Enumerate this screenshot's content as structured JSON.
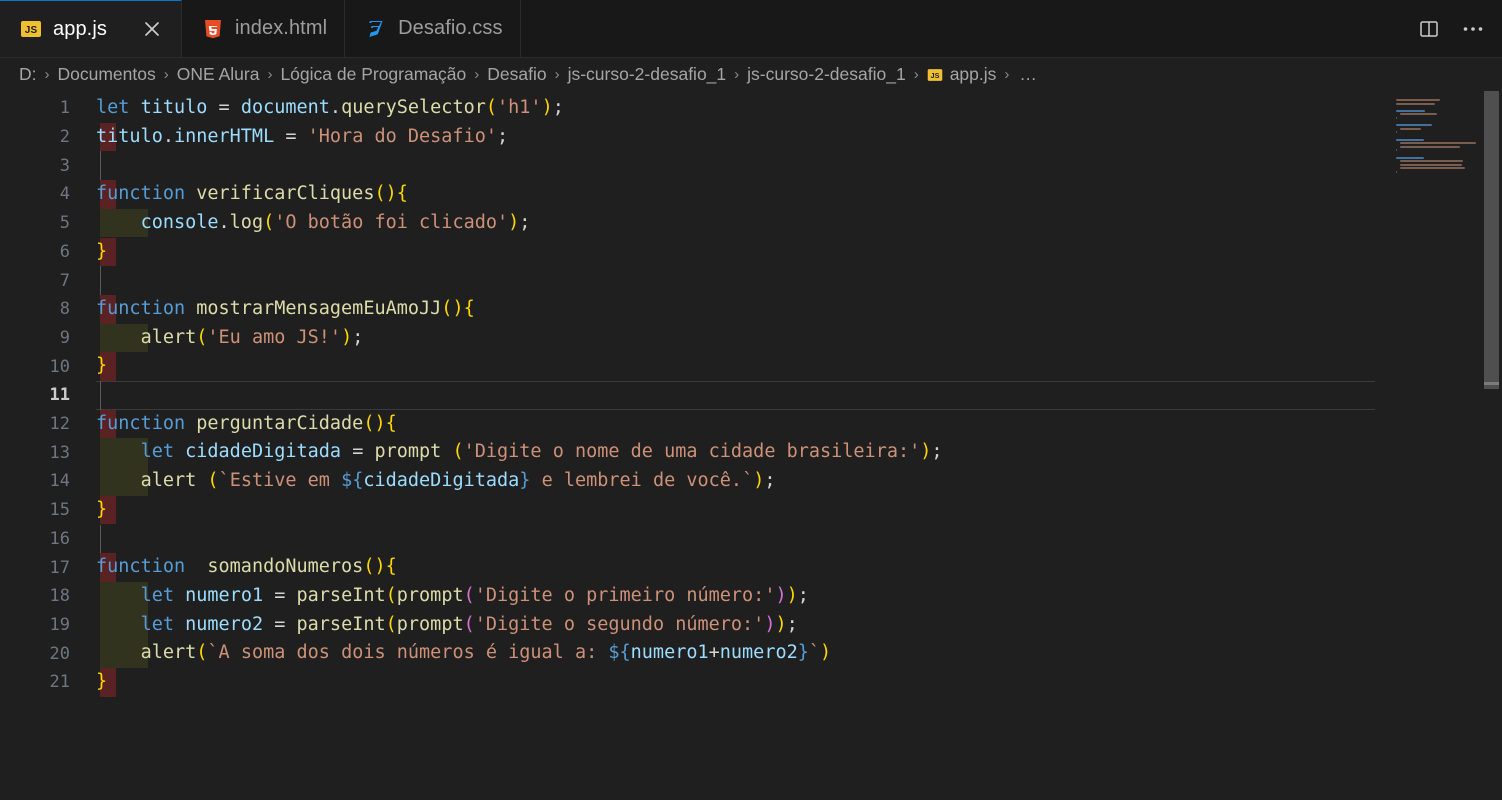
{
  "window": {
    "background": "#1f1f1f",
    "accent": "#0078d4"
  },
  "tabs": [
    {
      "label": "app.js",
      "icon": "js-file-icon",
      "active": true,
      "close_icon": "close-icon"
    },
    {
      "label": "index.html",
      "icon": "html-file-icon",
      "active": false
    },
    {
      "label": "Desafio.css",
      "icon": "css-file-icon",
      "active": false
    }
  ],
  "tab_actions": [
    {
      "name": "split-editor-right-icon",
      "label": "Split Editor Right"
    },
    {
      "name": "more-actions-icon",
      "label": "More Actions..."
    }
  ],
  "breadcrumb": {
    "separator": "›",
    "items": [
      {
        "label": "D:"
      },
      {
        "label": "Documentos"
      },
      {
        "label": "ONE Alura"
      },
      {
        "label": "Lógica de Programação"
      },
      {
        "label": "Desafio"
      },
      {
        "label": "js-curso-2-desafio_1"
      },
      {
        "label": "js-curso-2-desafio_1"
      },
      {
        "label": "app.js",
        "icon": "js-file-icon"
      }
    ],
    "ellipsis": "…"
  },
  "editor": {
    "active_line": 11,
    "language": "javascript",
    "lines": [
      {
        "n": 1,
        "git_modified": false,
        "indent_highlight": false,
        "text": "let titulo = document.querySelector('h1');"
      },
      {
        "n": 2,
        "git_modified": true,
        "indent_highlight": false,
        "text": "titulo.innerHTML = 'Hora do Desafio';"
      },
      {
        "n": 3,
        "git_modified": false,
        "indent_highlight": false,
        "text": ""
      },
      {
        "n": 4,
        "git_modified": true,
        "indent_highlight": false,
        "text": "function verificarCliques(){"
      },
      {
        "n": 5,
        "git_modified": false,
        "indent_highlight": true,
        "text": "    console.log('O botão foi clicado');"
      },
      {
        "n": 6,
        "git_modified": true,
        "indent_highlight": false,
        "text": "}"
      },
      {
        "n": 7,
        "git_modified": false,
        "indent_highlight": false,
        "text": ""
      },
      {
        "n": 8,
        "git_modified": true,
        "indent_highlight": false,
        "text": "function mostrarMensagemEuAmoJJ(){"
      },
      {
        "n": 9,
        "git_modified": false,
        "indent_highlight": true,
        "text": "    alert('Eu amo JS!');"
      },
      {
        "n": 10,
        "git_modified": true,
        "indent_highlight": false,
        "text": "}"
      },
      {
        "n": 11,
        "git_modified": false,
        "indent_highlight": false,
        "text": ""
      },
      {
        "n": 12,
        "git_modified": true,
        "indent_highlight": false,
        "text": "function perguntarCidade(){"
      },
      {
        "n": 13,
        "git_modified": false,
        "indent_highlight": true,
        "text": "    let cidadeDigitada = prompt ('Digite o nome de uma cidade brasileira:');"
      },
      {
        "n": 14,
        "git_modified": false,
        "indent_highlight": true,
        "text": "    alert (`Estive em ${cidadeDigitada} e lembrei de você.`);"
      },
      {
        "n": 15,
        "git_modified": true,
        "indent_highlight": false,
        "text": "}"
      },
      {
        "n": 16,
        "git_modified": false,
        "indent_highlight": false,
        "text": ""
      },
      {
        "n": 17,
        "git_modified": true,
        "indent_highlight": false,
        "text": "function  somandoNumeros(){"
      },
      {
        "n": 18,
        "git_modified": false,
        "indent_highlight": true,
        "text": "    let numero1 = parseInt(prompt('Digite o primeiro número:'));"
      },
      {
        "n": 19,
        "git_modified": false,
        "indent_highlight": true,
        "text": "    let numero2 = parseInt(prompt('Digite o segundo número:'));"
      },
      {
        "n": 20,
        "git_modified": false,
        "indent_highlight": true,
        "text": "    alert(`A soma dos dois números é igual a: ${numero1+numero2}`)"
      },
      {
        "n": 21,
        "git_modified": true,
        "indent_highlight": false,
        "text": "}"
      }
    ]
  },
  "minimap": {
    "name": "minimap",
    "visible": true
  },
  "scrollbar": {
    "name": "editor-vertical-scrollbar",
    "thumb_top_pct": 0,
    "thumb_height_pct": 42
  },
  "theme_colors": {
    "keyword": "#569cd6",
    "identifier": "#9cdcfe",
    "function": "#dcdcaa",
    "string": "#ce9178",
    "bracket_1": "#ffd700",
    "bracket_2": "#da70d6",
    "bracket_3": "#179fff",
    "git_modified": "#5a2223",
    "indent_highlight": "#32331f",
    "line_number": "#6e7681",
    "tab_bar": "#181818",
    "editor_bg": "#1f1f1f"
  }
}
